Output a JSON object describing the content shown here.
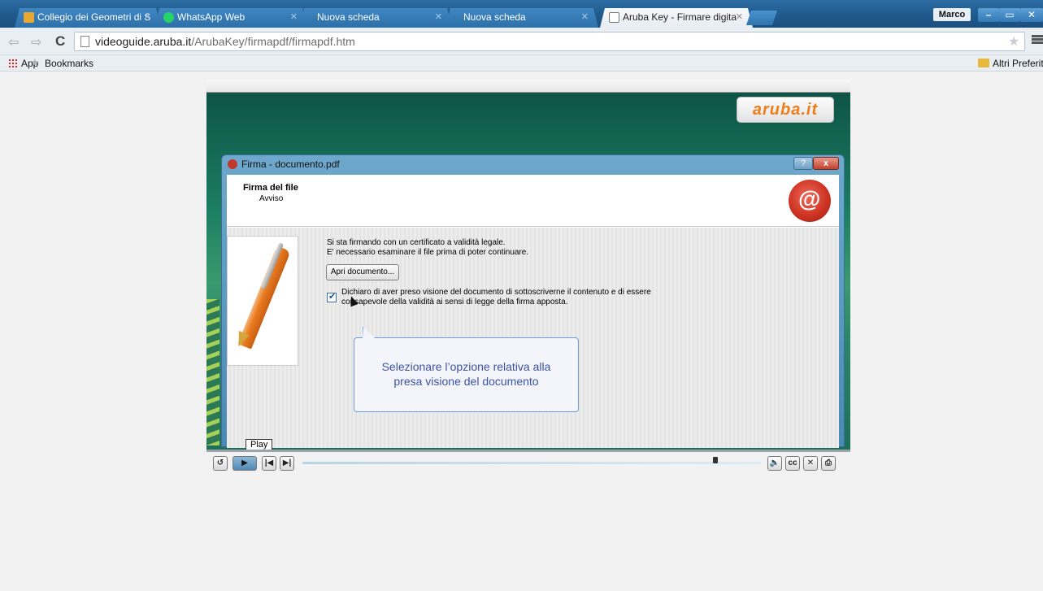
{
  "browser": {
    "tabs": [
      {
        "title": "Collegio dei Geometri di S",
        "active": false,
        "favicon_color": "#e8a632"
      },
      {
        "title": "WhatsApp Web",
        "active": false,
        "favicon_color": "#25d366"
      },
      {
        "title": "Nuova scheda",
        "active": false
      },
      {
        "title": "Nuova scheda",
        "active": false
      },
      {
        "title": "Aruba Key - Firmare digita",
        "active": true
      }
    ],
    "user": "Marco",
    "url_host": "videoguide.aruba.it",
    "url_path": "/ArubaKey/firmapdf/firmapdf.htm",
    "bookmarks": {
      "apps": "App",
      "bookmarks": "Bookmarks",
      "other": "Altri Preferiti"
    }
  },
  "video": {
    "logo": "aruba.it",
    "dialog": {
      "title": "Firma - documento.pdf",
      "help": "?",
      "close": "x",
      "header_title": "Firma del file",
      "header_subtitle": "Avviso",
      "line1": "Si sta firmando con un certificato a validità legale.",
      "line2": "E' necessario esaminare il file prima di poter continuare.",
      "open_button": "Apri documento...",
      "checkbox_line1": "Dichiaro di aver preso visione del documento di sottoscriverne il contenuto e di essere",
      "checkbox_line2": "consapevole della validità ai sensi di legge della firma apposta.",
      "checkbox_checked": true
    },
    "callout_line1": "Selezionare l’opzione relativa alla",
    "callout_line2": "presa visione del documento"
  },
  "player": {
    "tooltip": "Play",
    "buttons": {
      "replay": "↺",
      "play": "▶",
      "prev": "|◀",
      "next": "▶|",
      "volume": "🔈",
      "cc": "cc",
      "close": "✕",
      "print": "⎙"
    },
    "progress_fraction": 0.9
  },
  "colors": {
    "chrome_blue": "#2d6da3",
    "aruba_orange": "#ef7d1a",
    "callout_text": "#3c52a3"
  }
}
